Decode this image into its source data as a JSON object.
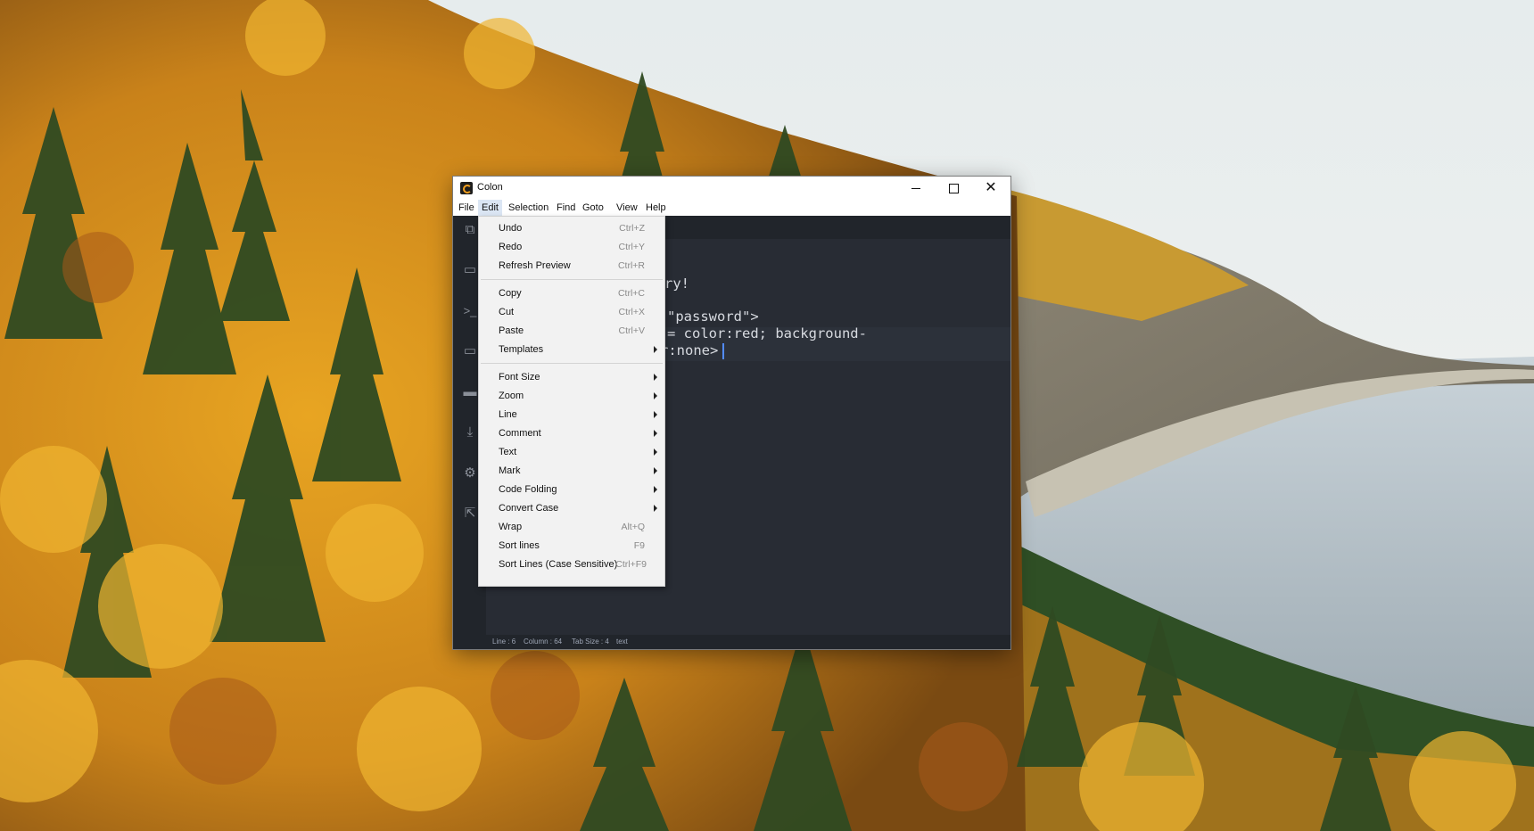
{
  "window": {
    "title": "Colon",
    "menus": [
      "File",
      "Edit",
      "Selection",
      "Find",
      "Goto",
      "View",
      "Help"
    ],
    "active_menu": "Edit"
  },
  "edit_menu": {
    "items": [
      {
        "label": "Undo",
        "shortcut": "Ctrl+Z"
      },
      {
        "label": "Redo",
        "shortcut": "Ctrl+Y"
      },
      {
        "label": "Refresh Preview",
        "shortcut": "Ctrl+R"
      },
      {
        "label": "Copy",
        "shortcut": "Ctrl+C"
      },
      {
        "label": "Cut",
        "shortcut": "Ctrl+X"
      },
      {
        "label": "Paste",
        "shortcut": "Ctrl+V"
      },
      {
        "label": "Templates",
        "submenu": true
      },
      {
        "label": "Font Size",
        "submenu": true
      },
      {
        "label": "Zoom",
        "submenu": true
      },
      {
        "label": "Line",
        "submenu": true
      },
      {
        "label": "Comment",
        "submenu": true
      },
      {
        "label": "Text",
        "submenu": true
      },
      {
        "label": "Mark",
        "submenu": true
      },
      {
        "label": "Code Folding",
        "submenu": true
      },
      {
        "label": "Convert Case",
        "submenu": true
      },
      {
        "label": "Wrap",
        "shortcut": "Alt+Q"
      },
      {
        "label": "Sort lines",
        "shortcut": "F9"
      },
      {
        "label": "Sort Lines (Case Sensitive)",
        "shortcut": "Ctrl+F9"
      }
    ]
  },
  "editor": {
    "visible_code_fragments": [
      "ry!",
      "\"password\">",
      "= color:red; background-",
      "r:none>"
    ]
  },
  "status_bar": {
    "line": "Line : 6",
    "column": "Column : 64",
    "tab_size": "Tab Size : 4",
    "mode": "text"
  },
  "activity_icons": [
    "copy-icon",
    "folder-icon",
    "terminal-icon",
    "preview-icon",
    "monitor-icon",
    "download-icon",
    "gear-icon",
    "share-icon"
  ]
}
